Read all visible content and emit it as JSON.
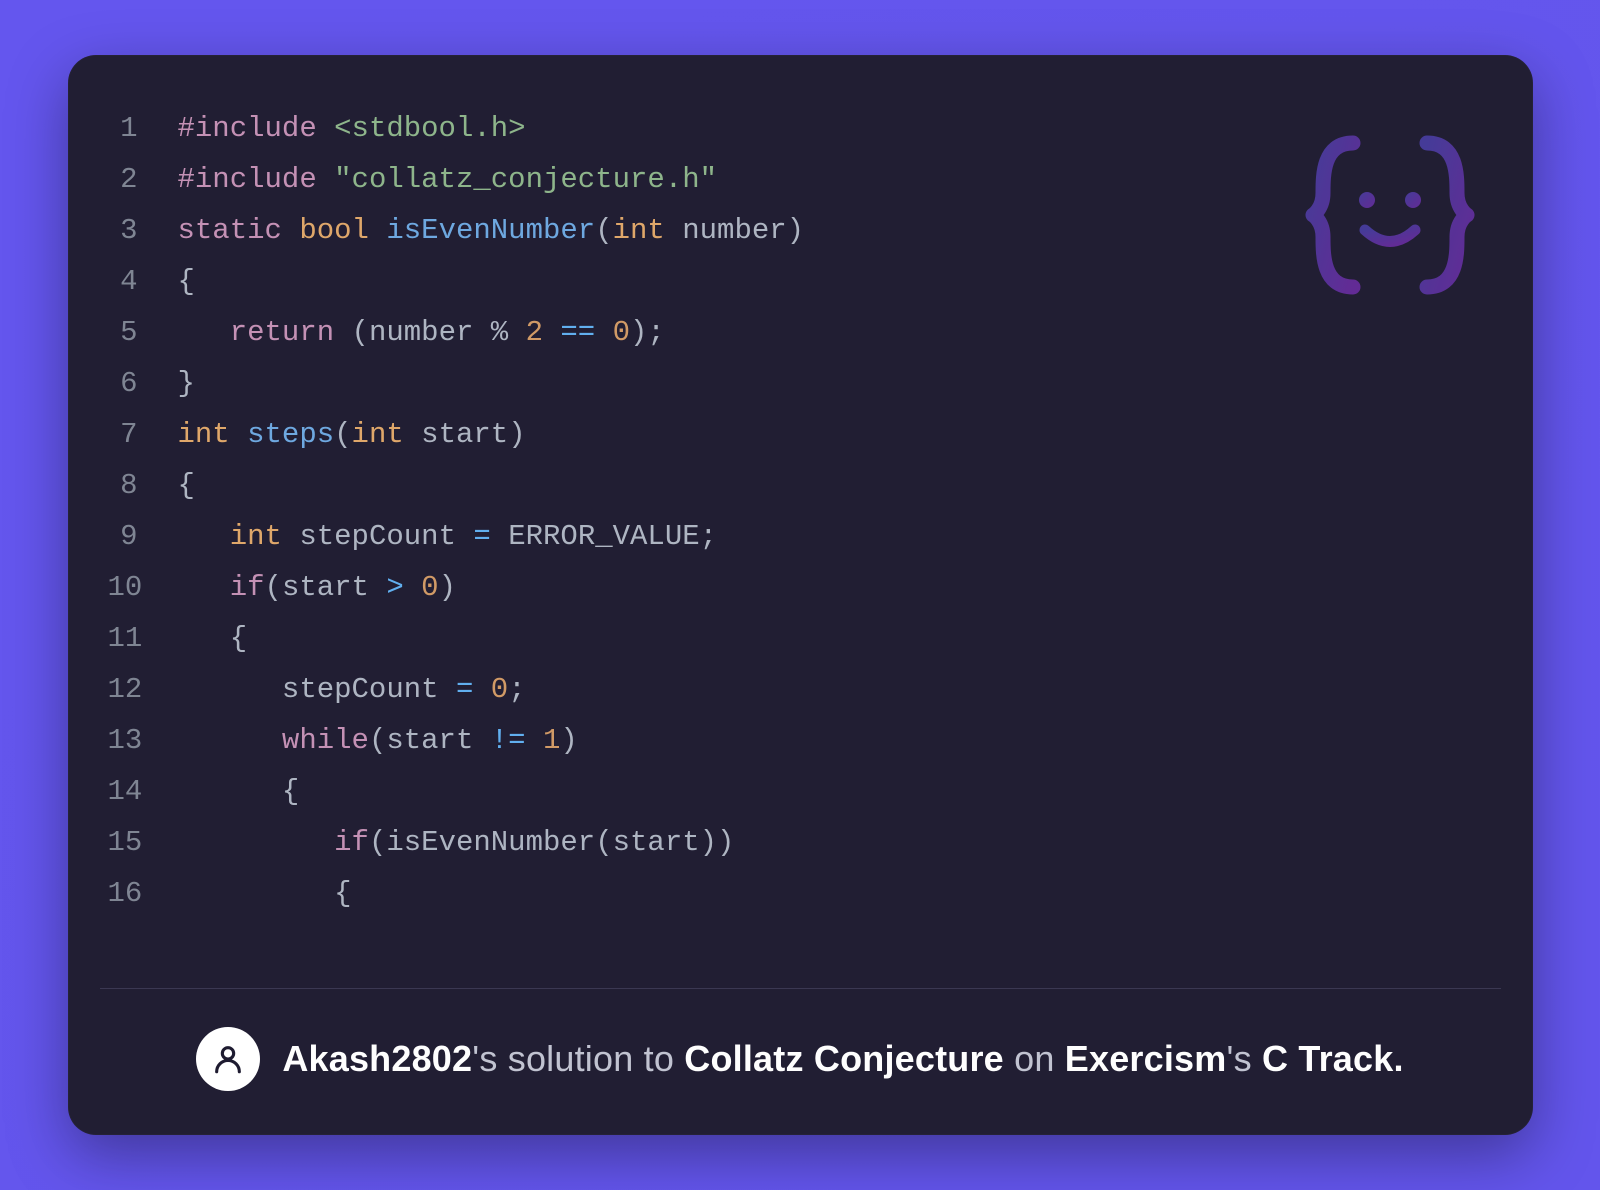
{
  "code": {
    "lines": [
      {
        "n": 1,
        "tokens": [
          [
            "meta",
            "#include"
          ],
          [
            "punc",
            " "
          ],
          [
            "string",
            "<stdbool.h>"
          ]
        ]
      },
      {
        "n": 2,
        "tokens": [
          [
            "meta",
            "#include"
          ],
          [
            "punc",
            " "
          ],
          [
            "string",
            "\"collatz_conjecture.h\""
          ]
        ]
      },
      {
        "n": 3,
        "tokens": [
          [
            "keyword",
            "static"
          ],
          [
            "punc",
            " "
          ],
          [
            "type",
            "bool"
          ],
          [
            "punc",
            " "
          ],
          [
            "func",
            "isEvenNumber"
          ],
          [
            "punc",
            "("
          ],
          [
            "type",
            "int"
          ],
          [
            "punc",
            " "
          ],
          [
            "ident",
            "number"
          ],
          [
            "punc",
            ")"
          ]
        ]
      },
      {
        "n": 4,
        "tokens": [
          [
            "punc",
            "{"
          ]
        ]
      },
      {
        "n": 5,
        "tokens": [
          [
            "punc",
            "   "
          ],
          [
            "keyword",
            "return"
          ],
          [
            "punc",
            " ("
          ],
          [
            "ident",
            "number"
          ],
          [
            "punc",
            " % "
          ],
          [
            "num",
            "2"
          ],
          [
            "punc",
            " "
          ],
          [
            "op",
            "=="
          ],
          [
            "punc",
            " "
          ],
          [
            "num",
            "0"
          ],
          [
            "punc",
            ");"
          ]
        ]
      },
      {
        "n": 6,
        "tokens": [
          [
            "punc",
            "}"
          ]
        ]
      },
      {
        "n": 7,
        "tokens": [
          [
            "type",
            "int"
          ],
          [
            "punc",
            " "
          ],
          [
            "func",
            "steps"
          ],
          [
            "punc",
            "("
          ],
          [
            "type",
            "int"
          ],
          [
            "punc",
            " "
          ],
          [
            "ident",
            "start"
          ],
          [
            "punc",
            ")"
          ]
        ]
      },
      {
        "n": 8,
        "tokens": [
          [
            "punc",
            "{"
          ]
        ]
      },
      {
        "n": 9,
        "tokens": [
          [
            "punc",
            "   "
          ],
          [
            "type",
            "int"
          ],
          [
            "punc",
            " "
          ],
          [
            "ident",
            "stepCount"
          ],
          [
            "punc",
            " "
          ],
          [
            "op",
            "="
          ],
          [
            "punc",
            " "
          ],
          [
            "const",
            "ERROR_VALUE"
          ],
          [
            "punc",
            ";"
          ]
        ]
      },
      {
        "n": 10,
        "tokens": [
          [
            "punc",
            "   "
          ],
          [
            "keyword",
            "if"
          ],
          [
            "punc",
            "("
          ],
          [
            "ident",
            "start"
          ],
          [
            "punc",
            " "
          ],
          [
            "op",
            ">"
          ],
          [
            "punc",
            " "
          ],
          [
            "num",
            "0"
          ],
          [
            "punc",
            ")"
          ]
        ]
      },
      {
        "n": 11,
        "tokens": [
          [
            "punc",
            "   {"
          ]
        ]
      },
      {
        "n": 12,
        "tokens": [
          [
            "punc",
            "      "
          ],
          [
            "ident",
            "stepCount"
          ],
          [
            "punc",
            " "
          ],
          [
            "op",
            "="
          ],
          [
            "punc",
            " "
          ],
          [
            "num",
            "0"
          ],
          [
            "punc",
            ";"
          ]
        ]
      },
      {
        "n": 13,
        "tokens": [
          [
            "punc",
            "      "
          ],
          [
            "keyword",
            "while"
          ],
          [
            "punc",
            "("
          ],
          [
            "ident",
            "start"
          ],
          [
            "punc",
            " "
          ],
          [
            "op",
            "!="
          ],
          [
            "punc",
            " "
          ],
          [
            "num",
            "1"
          ],
          [
            "punc",
            ")"
          ]
        ]
      },
      {
        "n": 14,
        "tokens": [
          [
            "punc",
            "      {"
          ]
        ]
      },
      {
        "n": 15,
        "tokens": [
          [
            "punc",
            "         "
          ],
          [
            "keyword",
            "if"
          ],
          [
            "punc",
            "("
          ],
          [
            "ident",
            "isEvenNumber"
          ],
          [
            "punc",
            "("
          ],
          [
            "ident",
            "start"
          ],
          [
            "punc",
            "))"
          ]
        ]
      },
      {
        "n": 16,
        "tokens": [
          [
            "punc",
            "         {"
          ]
        ]
      }
    ]
  },
  "footer": {
    "user": "Akash2802",
    "possessive": "'s ",
    "phrase1": "solution to ",
    "exercise": "Collatz Conjecture",
    "phrase2": " on ",
    "site": "Exercism",
    "possessive2": "'s ",
    "track": "C Track",
    "period": "."
  },
  "colors": {
    "bg": "#6456ee",
    "card": "#211e33"
  }
}
